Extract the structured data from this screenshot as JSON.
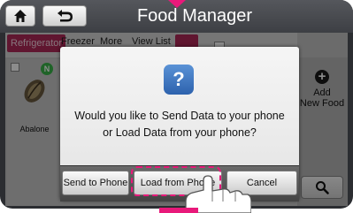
{
  "header": {
    "title": "Food Manager"
  },
  "tabs": [
    "Refrigerator",
    "Freezer",
    "More",
    "View List"
  ],
  "items": [
    {
      "label": "Abalone",
      "badge": "N"
    }
  ],
  "side_panel": {
    "add_label_line1": "Add",
    "add_label_line2": "New Food"
  },
  "dialog": {
    "icon_glyph": "?",
    "message": "Would you like to Send Data to your phone or Load Data from your phone?",
    "buttons": {
      "send": "Send to Phone",
      "load": "Load from Phone",
      "cancel": "Cancel"
    }
  },
  "colors": {
    "accent": "#e8197a",
    "tab_active": "#b02858",
    "badge": "#39b54a",
    "question_icon": "#3b73bf"
  },
  "icons": [
    "home-icon",
    "back-arrow-icon",
    "view-list-icon",
    "add-icon",
    "search-icon",
    "question-icon",
    "hand-pointer-icon"
  ]
}
